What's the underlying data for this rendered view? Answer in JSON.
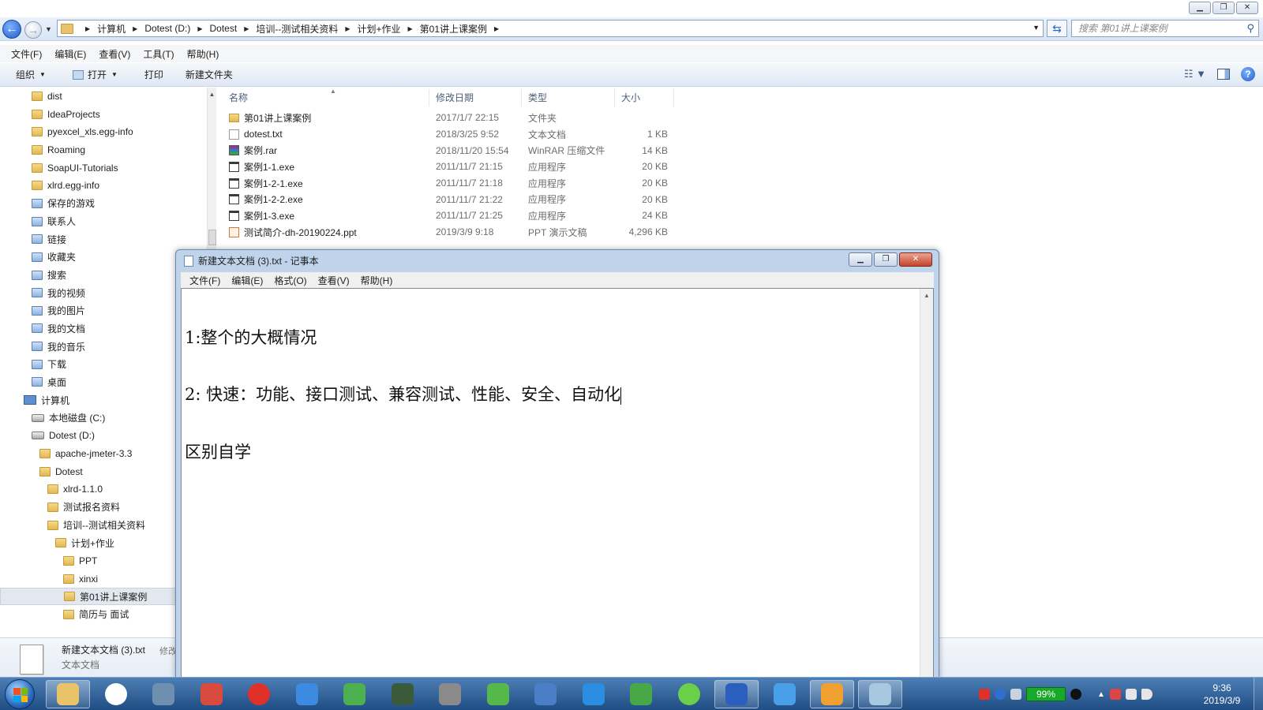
{
  "explorer": {
    "breadcrumbs": [
      "计算机",
      "Dotest (D:)",
      "Dotest",
      "培训--测试相关资料",
      "计划+作业",
      "第01讲上课案例"
    ],
    "search_placeholder": "搜索 第01讲上课案例",
    "menu": [
      "文件(F)",
      "编辑(E)",
      "查看(V)",
      "工具(T)",
      "帮助(H)"
    ],
    "commands": {
      "organize": "组织",
      "open": "打开",
      "print": "打印",
      "new_folder": "新建文件夹"
    },
    "columns": {
      "name": "名称",
      "date": "修改日期",
      "type": "类型",
      "size": "大小"
    },
    "files": [
      {
        "name": "第01讲上课案例",
        "date": "2017/1/7 22:15",
        "type": "文件夹",
        "size": "",
        "icon": "folder"
      },
      {
        "name": "dotest.txt",
        "date": "2018/3/25 9:52",
        "type": "文本文档",
        "size": "1 KB",
        "icon": "txt"
      },
      {
        "name": "案例.rar",
        "date": "2018/11/20 15:54",
        "type": "WinRAR 压缩文件",
        "size": "14 KB",
        "icon": "rar"
      },
      {
        "name": "案例1-1.exe",
        "date": "2011/11/7 21:15",
        "type": "应用程序",
        "size": "20 KB",
        "icon": "exe"
      },
      {
        "name": "案例1-2-1.exe",
        "date": "2011/11/7 21:18",
        "type": "应用程序",
        "size": "20 KB",
        "icon": "exe"
      },
      {
        "name": "案例1-2-2.exe",
        "date": "2011/11/7 21:22",
        "type": "应用程序",
        "size": "20 KB",
        "icon": "exe"
      },
      {
        "name": "案例1-3.exe",
        "date": "2011/11/7 21:25",
        "type": "应用程序",
        "size": "24 KB",
        "icon": "exe"
      },
      {
        "name": "测试简介-dh-20190224.ppt",
        "date": "2019/3/9 9:18",
        "type": "PPT 演示文稿",
        "size": "4,296 KB",
        "icon": "ppt"
      }
    ],
    "tree": [
      {
        "label": "dist",
        "icon": "folder",
        "level": 0
      },
      {
        "label": "IdeaProjects",
        "icon": "folder",
        "level": 0
      },
      {
        "label": "pyexcel_xls.egg-info",
        "icon": "folder",
        "level": 0
      },
      {
        "label": "Roaming",
        "icon": "folder",
        "level": 0
      },
      {
        "label": "SoapUI-Tutorials",
        "icon": "folder",
        "level": 0
      },
      {
        "label": "xlrd.egg-info",
        "icon": "folder",
        "level": 0
      },
      {
        "label": "保存的游戏",
        "icon": "special",
        "level": 0
      },
      {
        "label": "联系人",
        "icon": "special",
        "level": 0
      },
      {
        "label": "链接",
        "icon": "special",
        "level": 0
      },
      {
        "label": "收藏夹",
        "icon": "special",
        "level": 0
      },
      {
        "label": "搜索",
        "icon": "special",
        "level": 0
      },
      {
        "label": "我的视频",
        "icon": "special",
        "level": 0
      },
      {
        "label": "我的图片",
        "icon": "special",
        "level": 0
      },
      {
        "label": "我的文档",
        "icon": "special",
        "level": 0
      },
      {
        "label": "我的音乐",
        "icon": "special",
        "level": 0
      },
      {
        "label": "下载",
        "icon": "special",
        "level": 0
      },
      {
        "label": "桌面",
        "icon": "special",
        "level": 0
      },
      {
        "label": "计算机",
        "icon": "computer",
        "level": -1
      },
      {
        "label": "本地磁盘 (C:)",
        "icon": "drive",
        "level": 0
      },
      {
        "label": "Dotest (D:)",
        "icon": "drive",
        "level": 0
      },
      {
        "label": "apache-jmeter-3.3",
        "icon": "folder",
        "level": 1
      },
      {
        "label": "Dotest",
        "icon": "folder",
        "level": 1
      },
      {
        "label": "xlrd-1.1.0",
        "icon": "folder",
        "level": 2
      },
      {
        "label": "测试报名资料",
        "icon": "folder",
        "level": 2
      },
      {
        "label": "培训--测试相关资料",
        "icon": "folder",
        "level": 2
      },
      {
        "label": "计划+作业",
        "icon": "folder",
        "level": 3
      },
      {
        "label": "PPT",
        "icon": "folder",
        "level": 4
      },
      {
        "label": "xinxi",
        "icon": "folder",
        "level": 4
      },
      {
        "label": "第01讲上课案例",
        "icon": "folder",
        "level": 4,
        "selected": true
      },
      {
        "label": "简历与 面试",
        "icon": "folder",
        "level": 4
      }
    ],
    "details": {
      "name": "新建文本文档 (3).txt",
      "modified_prefix": "修改",
      "type": "文本文档"
    }
  },
  "notepad": {
    "title": "新建文本文档 (3).txt - 记事本",
    "menu": [
      "文件(F)",
      "编辑(E)",
      "格式(O)",
      "查看(V)",
      "帮助(H)"
    ],
    "lines": [
      "1:整个的大概情况",
      "2: 快速：功能、接口测试、兼容测试、性能、安全、自动化",
      "区别自学"
    ]
  },
  "taskbar": {
    "apps": [
      "explorer",
      "chrome",
      "media-player",
      "paint-tool",
      "netease-music",
      "baidu-netdisk",
      "leaf-app",
      "terminal",
      "remote-desktop",
      "green-app",
      "document-app",
      "blue-bird-app",
      "refresh-app",
      "wechat",
      "wps",
      "arrow-app",
      "winrar",
      "notepad"
    ],
    "battery": "99%",
    "time": "9:36",
    "date": "2019/3/9"
  }
}
